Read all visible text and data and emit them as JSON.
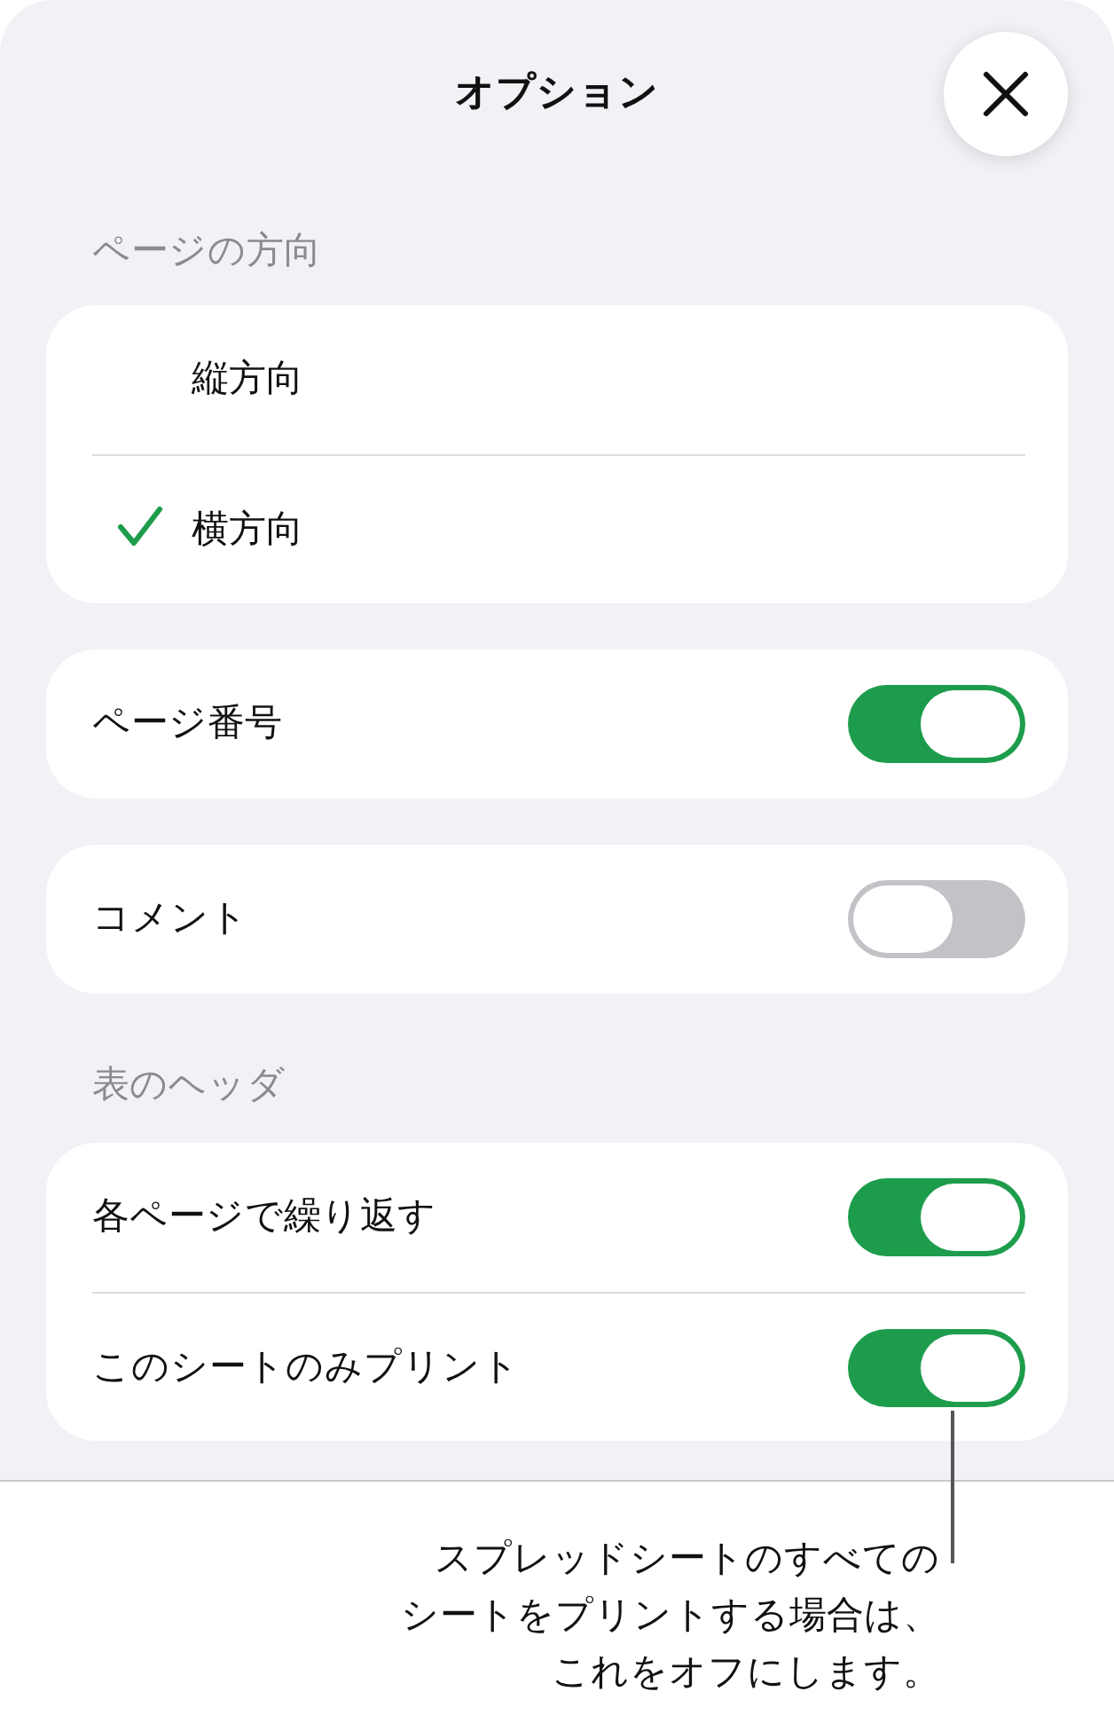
{
  "title": "オプション",
  "sections": [
    {
      "header": "ページの方向",
      "groups": [
        {
          "rows": [
            {
              "kind": "check",
              "label": "縦方向",
              "selected": false
            },
            {
              "kind": "check",
              "label": "横方向",
              "selected": true
            }
          ]
        },
        {
          "rows": [
            {
              "kind": "toggle",
              "label": "ページ番号",
              "on": true
            }
          ]
        },
        {
          "rows": [
            {
              "kind": "toggle",
              "label": "コメント",
              "on": false
            }
          ]
        }
      ]
    },
    {
      "header": "表のヘッダ",
      "groups": [
        {
          "rows": [
            {
              "kind": "toggle",
              "label": "各ページで繰り返す",
              "on": true
            },
            {
              "kind": "toggle",
              "label": "このシートのみプリント",
              "on": true
            }
          ]
        }
      ]
    }
  ],
  "callout": {
    "lines": [
      "スプレッドシートのすべての",
      "シートをプリントする場合は、",
      "これをオフにします。"
    ]
  }
}
